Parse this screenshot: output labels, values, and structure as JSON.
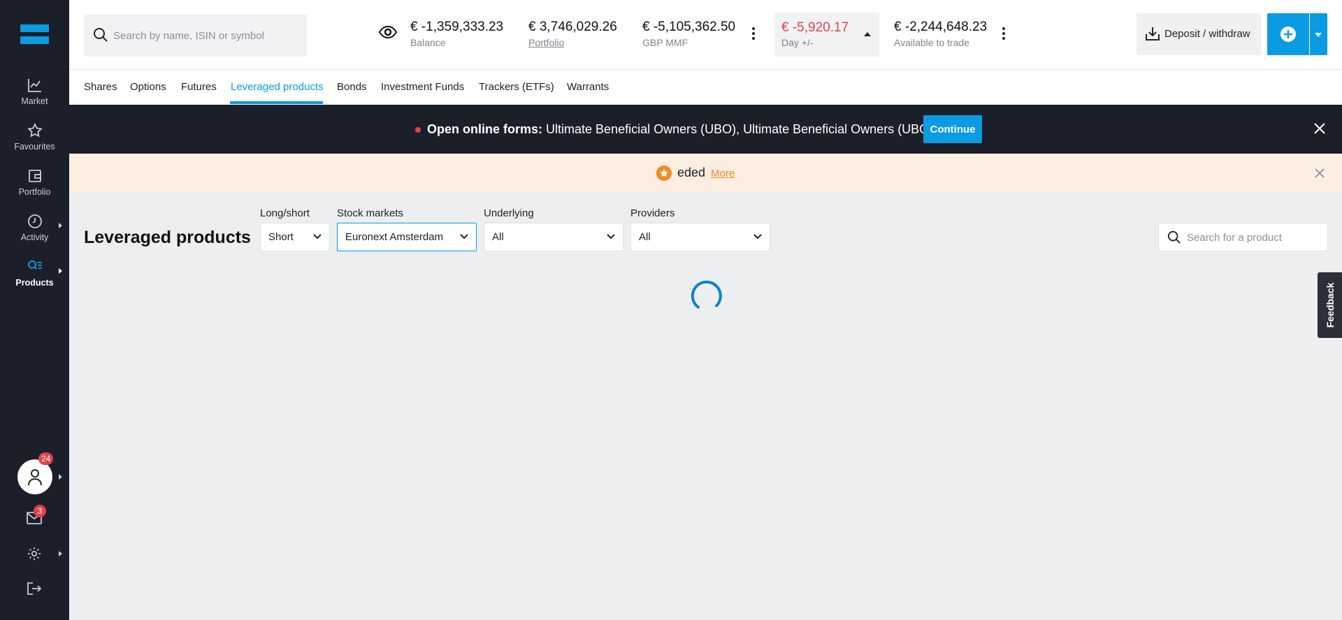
{
  "sidebar": {
    "items": [
      {
        "label": "Market",
        "icon": "chart-line-icon"
      },
      {
        "label": "Favourites",
        "icon": "star-icon"
      },
      {
        "label": "Portfolio",
        "icon": "wallet-icon"
      },
      {
        "label": "Activity",
        "icon": "clock-icon"
      },
      {
        "label": "Products",
        "icon": "search-list-icon"
      }
    ],
    "active_item": "Products",
    "profile_badge": "24",
    "messages_badge": "3"
  },
  "header": {
    "search_placeholder": "Search by name, ISIN or symbol",
    "balance": {
      "value": "€ -1,359,333.23",
      "label": "Balance"
    },
    "portfolio": {
      "value": "€ 3,746,029.26",
      "label": "Portfolio"
    },
    "gbp_mmf": {
      "value": "€ -5,105,362.50",
      "label": "GBP MMF"
    },
    "day_change": {
      "value": "€ -5,920.17",
      "label": "Day +/-"
    },
    "available": {
      "value": "€ -2,244,648.23",
      "label": "Available to trade"
    },
    "deposit_label": "Deposit / withdraw"
  },
  "tabs": {
    "items": [
      "Shares",
      "Options",
      "Futures",
      "Leveraged products",
      "Bonds",
      "Investment Funds",
      "Trackers (ETFs)",
      "Warrants"
    ],
    "active": "Leveraged products"
  },
  "banner_forms": {
    "title": "Open online forms:",
    "text": "Ultimate Beneficial Owners (UBO), Ultimate Beneficial Owners (UBO) ...",
    "button": "Continue"
  },
  "banner_notice": {
    "text": "eded",
    "link": "More"
  },
  "content": {
    "title": "Leveraged products",
    "filters": {
      "long_short": {
        "label": "Long/short",
        "value": "Short"
      },
      "stock_markets": {
        "label": "Stock markets",
        "value": "Euronext Amsterdam"
      },
      "underlying": {
        "label": "Underlying",
        "value": "All"
      },
      "providers": {
        "label": "Providers",
        "value": "All"
      }
    },
    "search_placeholder": "Search for a product"
  },
  "feedback_label": "Feedback",
  "colors": {
    "accent": "#0a9be2",
    "negative": "#e0434b",
    "sidebar": "#1b1f2a",
    "warning": "#f08a24"
  }
}
